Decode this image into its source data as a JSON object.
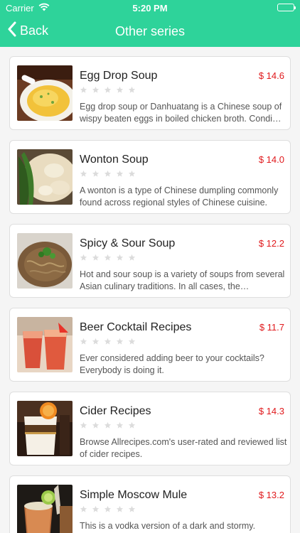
{
  "status_bar": {
    "carrier": "Carrier",
    "time": "5:20 PM"
  },
  "nav": {
    "back_label": "Back",
    "title": "Other series"
  },
  "items": [
    {
      "name": "Egg Drop Soup",
      "price": "$ 14.6",
      "rating": 0,
      "description": "Egg drop soup or Danhuatang is a Chinese soup of wispy beaten eggs in boiled chicken broth. Condi…"
    },
    {
      "name": "Wonton Soup",
      "price": "$ 14.0",
      "rating": 0,
      "description": "A wonton is a type of Chinese dumpling commonly found across regional styles of Chinese cuisine."
    },
    {
      "name": "Spicy & Sour Soup",
      "price": "$ 12.2",
      "rating": 0,
      "description": "Hot and sour soup is a variety of soups from several Asian culinary traditions. In all cases, the…"
    },
    {
      "name": "Beer Cocktail Recipes",
      "price": "$ 11.7",
      "rating": 0,
      "description": "Ever considered adding beer to your cocktails? Everybody is doing it."
    },
    {
      "name": "Cider Recipes",
      "price": "$ 14.3",
      "rating": 0,
      "description": "Browse Allrecipes.com's user-rated and reviewed list of cider recipes."
    },
    {
      "name": "Simple Moscow Mule",
      "price": "$ 13.2",
      "rating": 0,
      "description": "This is a vodka version of a dark and stormy."
    }
  ],
  "colors": {
    "accent": "#2ed39a",
    "price": "#e0191c",
    "star_empty": "#dcdcdc"
  }
}
